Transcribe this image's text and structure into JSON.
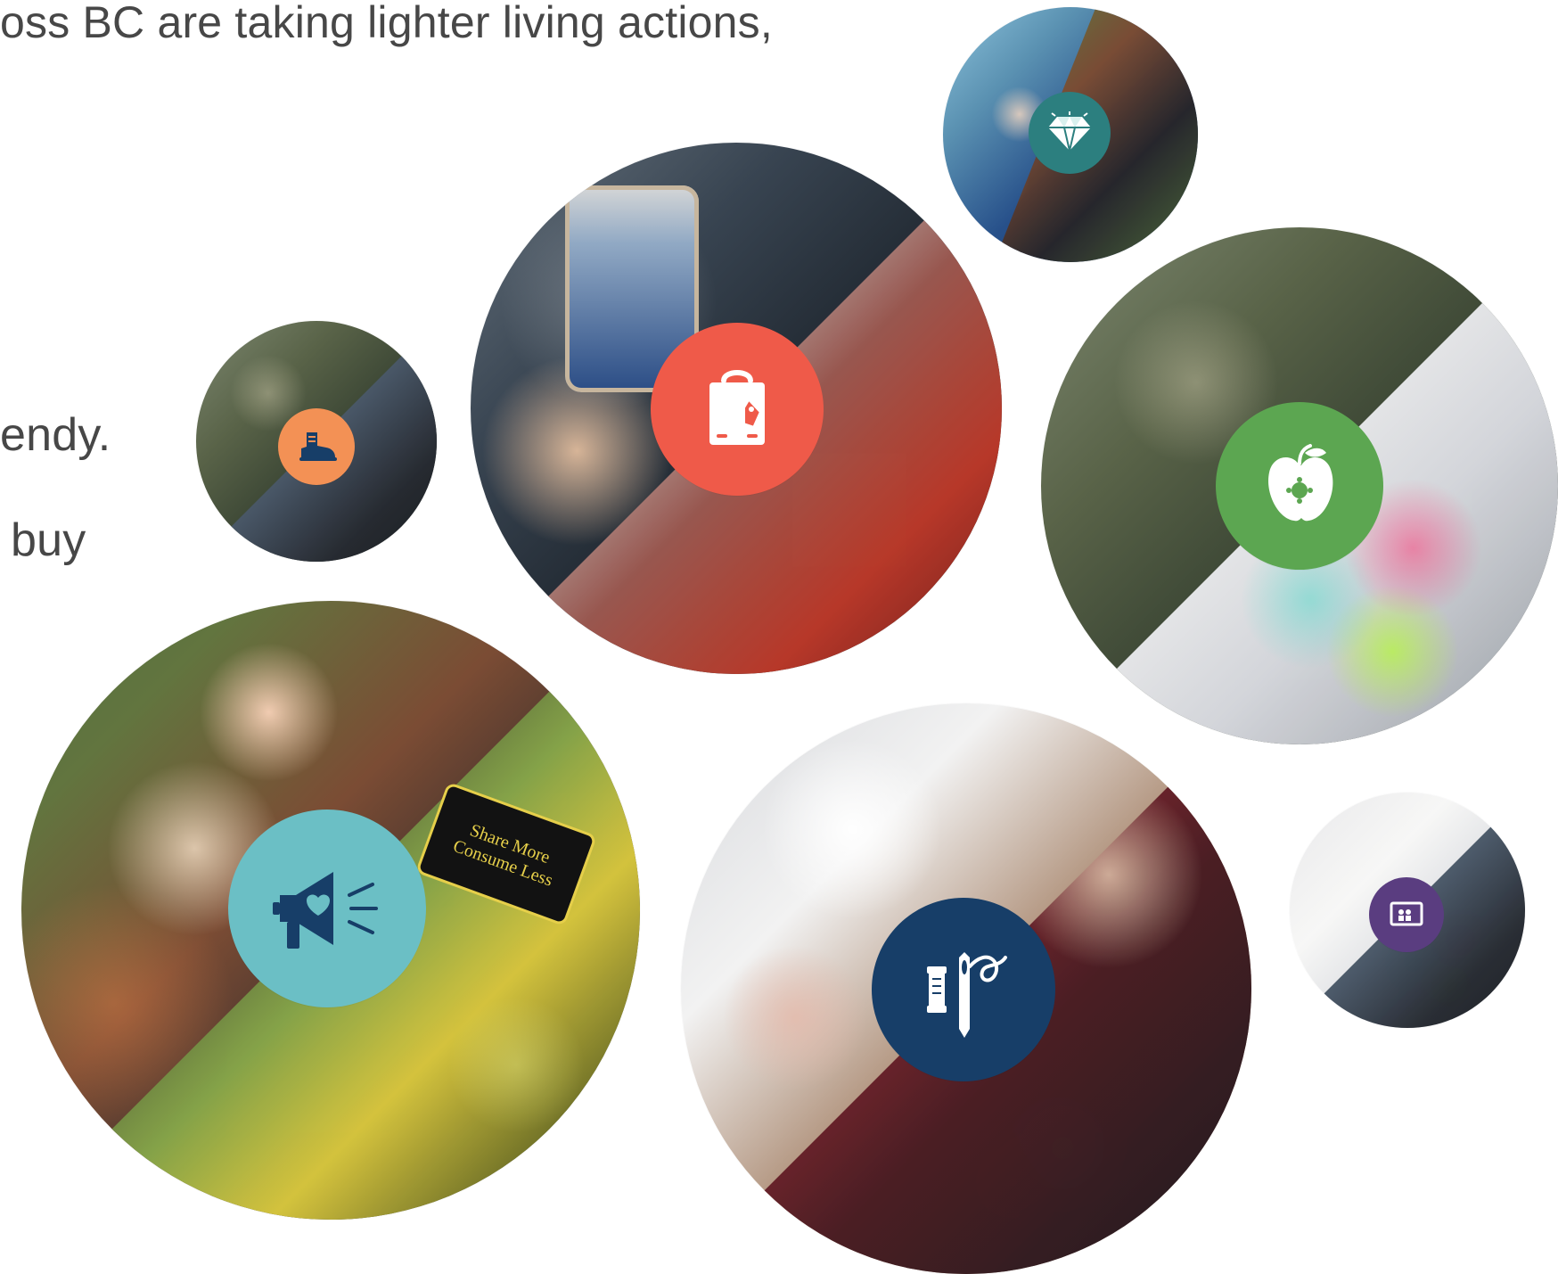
{
  "text": {
    "line1": "oss BC are taking lighter living actions,",
    "line2": "endy.",
    "line3": "buy"
  },
  "bubbles": [
    {
      "name": "swim-formal-bubble",
      "icon": "diamond-icon",
      "badge_color": "#2c7f7f"
    },
    {
      "name": "phone-shopping-bubble",
      "icon": "shopping-bag-icon",
      "badge_color": "#ef5a49"
    },
    {
      "name": "outdoor-bike-bubble",
      "icon": "boot-icon",
      "badge_color": "#f39155"
    },
    {
      "name": "food-fridge-bubble",
      "icon": "apple-icon",
      "badge_color": "#5ca651"
    },
    {
      "name": "share-more-consume-less-bubble",
      "icon": "megaphone-heart-icon",
      "badge_color": "#6bbfc5",
      "sign_line1": "Share More",
      "sign_line2": "Consume Less"
    },
    {
      "name": "sewing-preserves-bubble",
      "icon": "sewing-needle-icon",
      "badge_color": "#173e68"
    },
    {
      "name": "bulk-goods-bubble",
      "icon": "photo-frame-icon",
      "badge_color": "#5a3d80"
    }
  ]
}
